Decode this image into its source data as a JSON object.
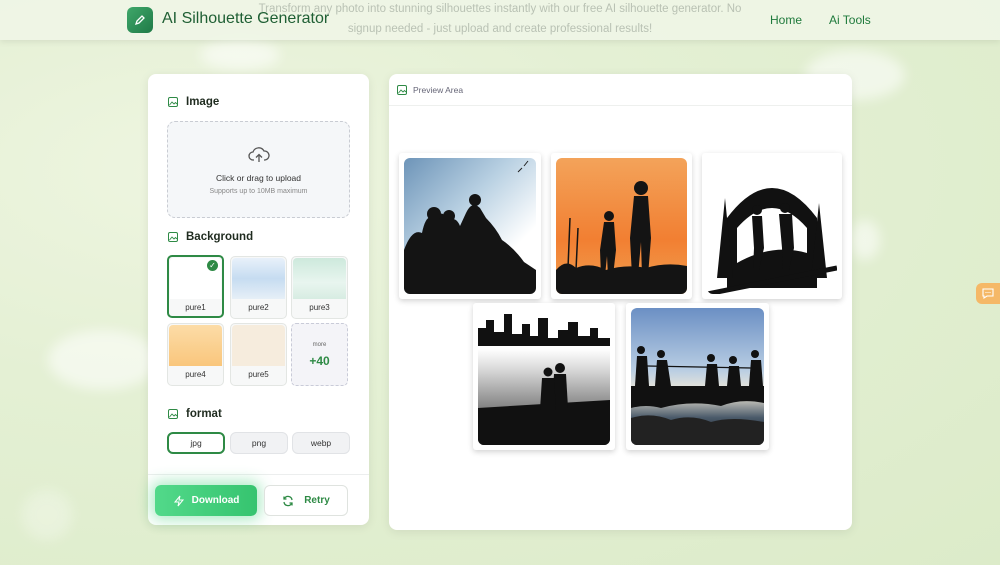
{
  "header": {
    "brand": "AI Silhouette Generator",
    "tagline_line1": "Transform any photo into stunning silhouettes instantly with our free AI silhouette generator. No",
    "tagline_line2": "signup needed - just upload and create professional results!",
    "nav": [
      "Home",
      "Ai Tools"
    ]
  },
  "panel": {
    "image_title": "Image",
    "upload_text": "Click or drag to upload",
    "upload_hint": "Supports up to 10MB maximum",
    "background_title": "Background",
    "backgrounds": [
      {
        "label": "pure1",
        "color": "#ffffff",
        "selected": true
      },
      {
        "label": "pure2",
        "color": "#cfe3f5",
        "selected": false
      },
      {
        "label": "pure3",
        "color": "#d7efe4",
        "selected": false
      },
      {
        "label": "pure4",
        "color": "#fbd39a",
        "selected": false
      },
      {
        "label": "pure5",
        "color": "#f6ecdd",
        "selected": false
      }
    ],
    "more_label": "more",
    "more_count": "+40",
    "format_title": "format",
    "formats": [
      "jpg",
      "png",
      "webp"
    ],
    "selected_format": "jpg",
    "download_label": "Download",
    "retry_label": "Retry"
  },
  "preview": {
    "title": "Preview Area"
  },
  "colors": {
    "accent": "#2e8a45",
    "download": "#3fd07b"
  }
}
